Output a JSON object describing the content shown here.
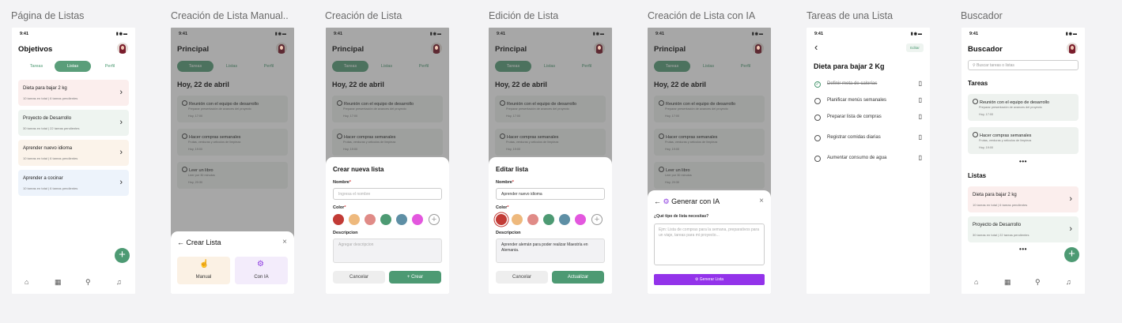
{
  "captions": [
    "Página de Listas",
    "Creación de Lista Manual..",
    "Creación de Lista",
    "Edición de Lista",
    "Creación de Lista con IA",
    "Tareas de una Lista",
    "Buscador"
  ],
  "status": {
    "time": "9:41",
    "icons": "▮◉▬"
  },
  "tabs": [
    "Tareas",
    "Listas",
    "Perfil"
  ],
  "icons": {
    "home": "⌂",
    "calendar": "▦",
    "search": "⚲",
    "bell": "♫",
    "chevron": "›",
    "back": "‹",
    "plus": "+",
    "trash": "▯"
  },
  "lists": [
    {
      "title": "Dieta para bajar 2 kg",
      "meta": "10 tareas en total | 6 tareas pendientes",
      "color": "#fbeeed"
    },
    {
      "title": "Proyecto de Desarrollo",
      "meta": "30 tareas en total | 22 tareas pendientes",
      "color": "#eef4f0"
    },
    {
      "title": "Aprender nuevo idioma",
      "meta": "10 tareas en total | 6 tareas pendientes",
      "color": "#fbf3ea"
    },
    {
      "title": "Aprender a cocinar",
      "meta": "10 tareas en total | 6 tareas pendientes",
      "color": "#edf3fb"
    }
  ],
  "screen1": {
    "title": "Objetivos"
  },
  "principal": {
    "title": "Principal",
    "date": "Hoy, 22 de abril",
    "tasks": [
      {
        "title": "Reunión con el equipo de desarrollo",
        "desc": "Preparar presentación de avances del proyecto",
        "time": "Hoy, 17:00"
      },
      {
        "title": "Hacer compras semanales",
        "desc": "Frutas, verduras y artículos de limpieza",
        "time": "Hoy, 19:00"
      },
      {
        "title": "Leer un libro",
        "desc": "Leer por 30 minutos",
        "time": "Hoy, 20:30"
      }
    ]
  },
  "crear_lista_sheet": {
    "title": "Crear Lista",
    "manual": "Manual",
    "ia": "Con IA",
    "close": "×",
    "back": "←"
  },
  "nueva_lista": {
    "title": "Crear nueva lista",
    "name_label": "Nombre",
    "name_placeholder": "Ingresa el nombre",
    "color_label": "Color",
    "desc_label": "Descripcion",
    "desc_placeholder": "Agregar descripcion",
    "cancel": "Cancelar",
    "create": "+ Crear",
    "req": "*"
  },
  "colors": [
    "#c23b36",
    "#eeb97d",
    "#e08b87",
    "#4d9a73",
    "#5e8fa5",
    "#e357de"
  ],
  "editar_lista": {
    "title": "Editar lista",
    "name_value": "Aprender nuevo idioma",
    "desc_value": "Aprender alemán para poder realizar Maestría en Alemania.",
    "cancel": "Cancelar",
    "update": "Actualizar"
  },
  "ia": {
    "title": "Generar con IA",
    "question": "¿Qué tipo de lista necesitas?",
    "placeholder": "Ejm: Lista de compras para la semana, preparativos para un viaje, tareas para mi proyecto...",
    "button": "Generar Lista",
    "back": "←",
    "close": "×"
  },
  "tareas_lista": {
    "title": "Dieta para bajar 2 Kg",
    "edit": "Editar",
    "tasks": [
      "Definir meta de calorías",
      "Planificar menús semanales",
      "Preparar lista de compras",
      "Registrar comidas diarias",
      "Aumentar consumo de agua"
    ]
  },
  "buscador": {
    "title": "Buscador",
    "search_placeholder": "Buscar tareas o listas",
    "tareas": "Tareas",
    "listas": "Listas",
    "dots": "•••"
  }
}
